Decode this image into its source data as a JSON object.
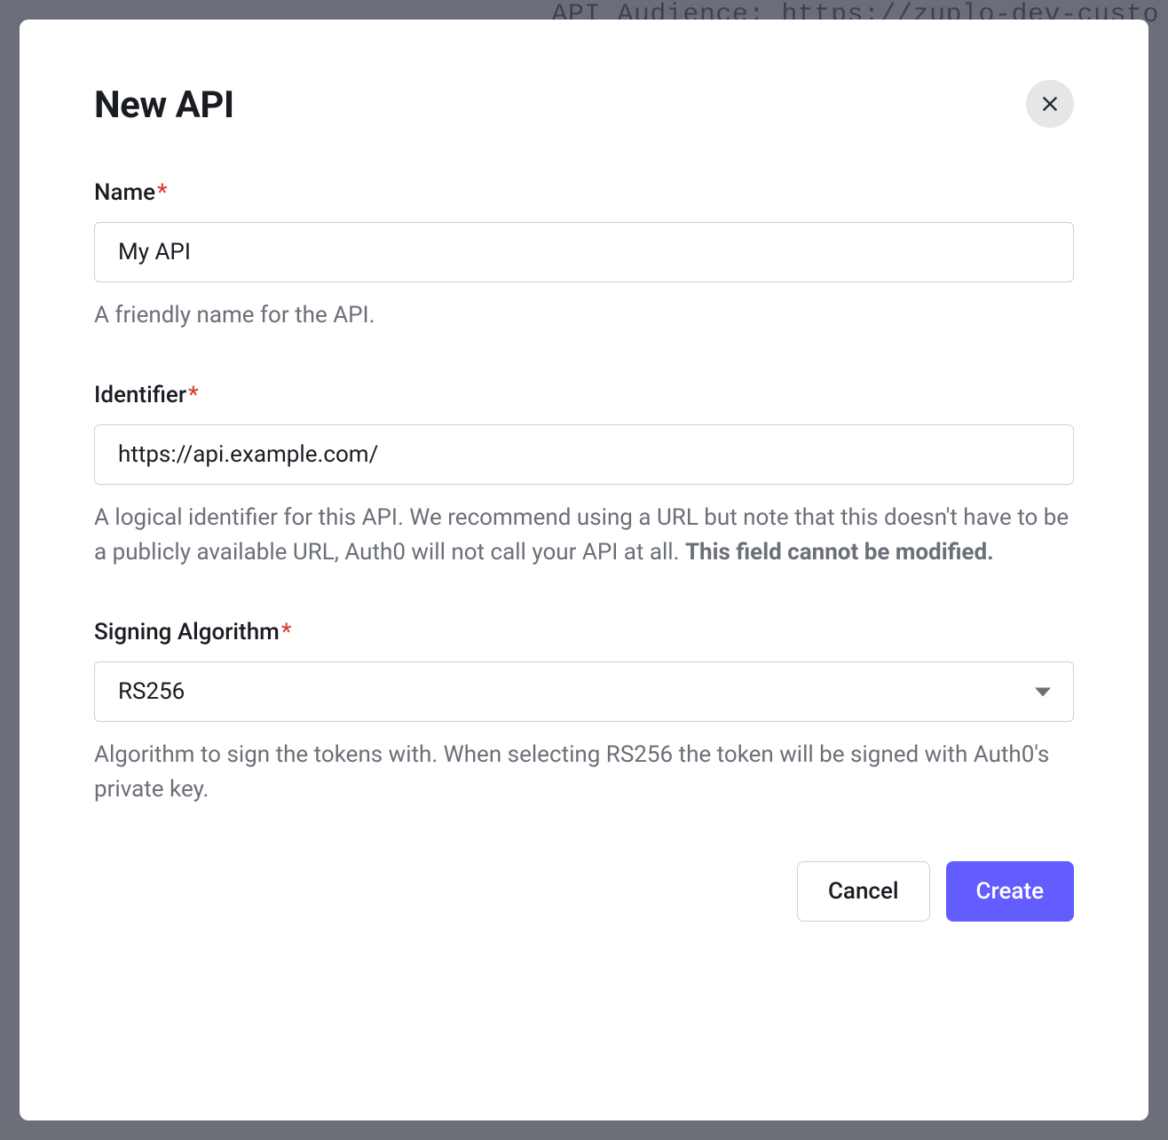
{
  "background": {
    "text": "API Audience:  https://zuplo-dev-custo"
  },
  "modal": {
    "title": "New API",
    "fields": {
      "name": {
        "label": "Name",
        "required": "*",
        "value": "My API",
        "help": "A friendly name for the API."
      },
      "identifier": {
        "label": "Identifier",
        "required": "*",
        "value": "https://api.example.com/",
        "help_prefix": "A logical identifier for this API. We recommend using a URL but note that this doesn't have to be a publicly available URL, Auth0 will not call your API at all. ",
        "help_bold": "This field cannot be modified."
      },
      "algorithm": {
        "label": "Signing Algorithm",
        "required": "*",
        "selected": "RS256",
        "help": "Algorithm to sign the tokens with. When selecting RS256 the token will be signed with Auth0's private key."
      }
    },
    "buttons": {
      "cancel": "Cancel",
      "create": "Create"
    }
  }
}
